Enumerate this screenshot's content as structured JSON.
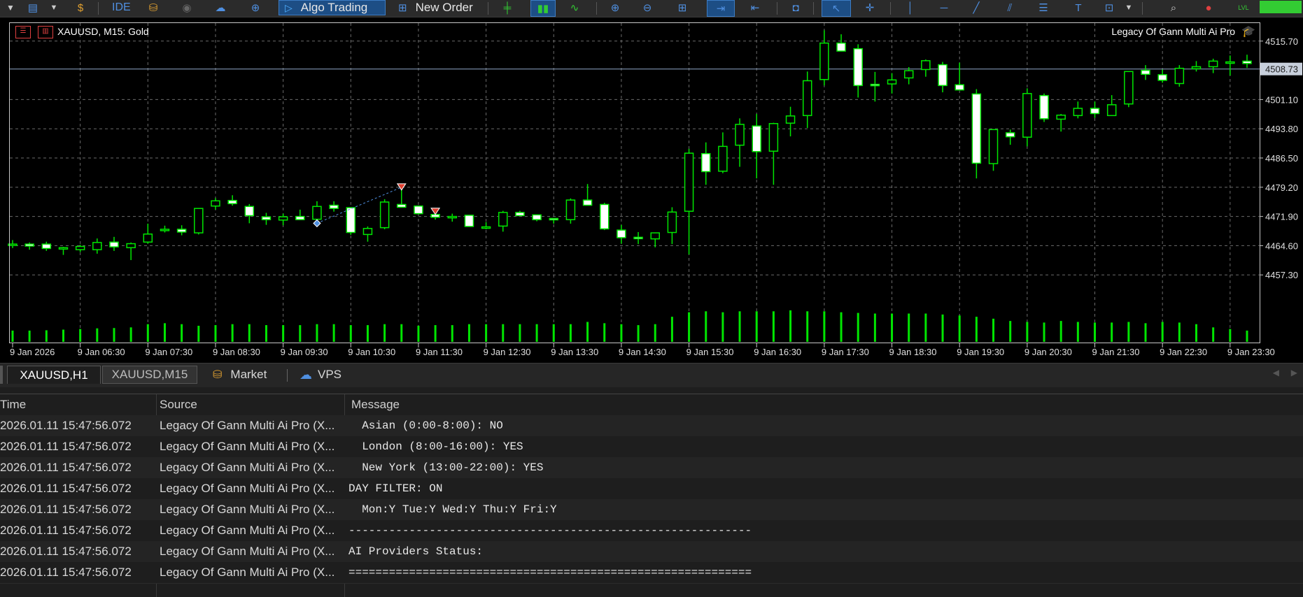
{
  "toolbar": {
    "algo_trading_label": "Algo Trading",
    "new_order_label": "New Order",
    "ide_label": "IDE",
    "lvl_label": "LVL"
  },
  "chart": {
    "title": "XAUUSD, M15:  Gold",
    "indicator_title": "Legacy Of Gann Multi Ai Pro",
    "current_price_label": "4508.73",
    "colors": {
      "bull_body": "#000000",
      "bear_body": "#ffffff",
      "wick": "#00e600",
      "volume": "#00e600",
      "grid": "#6b6b6b",
      "price_line": "#8fa8c8"
    }
  },
  "chart_data": {
    "type": "candlestick",
    "symbol": "XAUUSD",
    "timeframe": "M15",
    "y_ticks": [
      4515.7,
      4508.73,
      4501.1,
      4493.8,
      4486.5,
      4479.2,
      4471.9,
      4464.6,
      4457.3
    ],
    "y_range": [
      4454.2,
      4520.2
    ],
    "x_ticks": [
      "9 Jan 2026",
      "9 Jan 06:30",
      "9 Jan 07:30",
      "9 Jan 08:30",
      "9 Jan 09:30",
      "9 Jan 10:30",
      "9 Jan 11:30",
      "9 Jan 12:30",
      "9 Jan 13:30",
      "9 Jan 14:30",
      "9 Jan 15:30",
      "9 Jan 16:30",
      "9 Jan 17:30",
      "9 Jan 18:30",
      "9 Jan 19:30",
      "9 Jan 20:30",
      "9 Jan 21:30",
      "9 Jan 22:30",
      "9 Jan 23:30"
    ],
    "current_price": 4508.73,
    "candles": [
      [
        4465.0,
        4466.0,
        4464.0,
        4465.0
      ],
      [
        4465.0,
        4465.4,
        4463.6,
        4464.5
      ],
      [
        4465.0,
        4465.6,
        4463.3,
        4463.9
      ],
      [
        4464.1,
        4464.3,
        4462.3,
        4464.1
      ],
      [
        4463.6,
        4464.8,
        4463.0,
        4464.4
      ],
      [
        4463.6,
        4466.4,
        4462.6,
        4465.4
      ],
      [
        4465.5,
        4466.8,
        4463.3,
        4464.3
      ],
      [
        4464.1,
        4465.4,
        4461.0,
        4465.1
      ],
      [
        4465.5,
        4470.1,
        4465.1,
        4467.5
      ],
      [
        4468.5,
        4469.6,
        4467.9,
        4468.7
      ],
      [
        4468.7,
        4469.7,
        4467.2,
        4468.0
      ],
      [
        4467.8,
        4473.9,
        4467.4,
        4473.9
      ],
      [
        4474.5,
        4476.5,
        4473.6,
        4475.8
      ],
      [
        4475.9,
        4477.2,
        4474.6,
        4475.1
      ],
      [
        4474.4,
        4475.0,
        4470.2,
        4472.1
      ],
      [
        4471.8,
        4472.8,
        4469.8,
        4471.1
      ],
      [
        4471.0,
        4472.6,
        4469.7,
        4471.8
      ],
      [
        4471.9,
        4473.6,
        4471.3,
        4471.1
      ],
      [
        4471.2,
        4475.7,
        4470.1,
        4474.4
      ],
      [
        4474.7,
        4475.7,
        4473.1,
        4473.9
      ],
      [
        4474.1,
        4474.1,
        4467.3,
        4467.9
      ],
      [
        4467.4,
        4469.4,
        4465.6,
        4468.9
      ],
      [
        4469.1,
        4476.2,
        4468.7,
        4475.5
      ],
      [
        4474.9,
        4478.8,
        4474.9,
        4474.2
      ],
      [
        4474.5,
        4474.5,
        4472.4,
        4472.6
      ],
      [
        4472.4,
        4473.3,
        4471.1,
        4471.7
      ],
      [
        4471.7,
        4472.6,
        4470.6,
        4471.9
      ],
      [
        4472.2,
        4472.2,
        4469.3,
        4469.4
      ],
      [
        4469.2,
        4470.5,
        4468.7,
        4469.3
      ],
      [
        4469.5,
        4473.3,
        4468.1,
        4472.9
      ],
      [
        4472.9,
        4473.3,
        4472.2,
        4472.1
      ],
      [
        4472.3,
        4472.4,
        4470.7,
        4471.1
      ],
      [
        4471.4,
        4471.4,
        4470.1,
        4471.1
      ],
      [
        4471.1,
        4476.4,
        4470.1,
        4476.0
      ],
      [
        4476.0,
        4480.0,
        4474.9,
        4474.7
      ],
      [
        4474.9,
        4475.3,
        4468.5,
        4468.8
      ],
      [
        4468.5,
        4469.8,
        4465.1,
        4466.6
      ],
      [
        4466.7,
        4468.0,
        4465.0,
        4466.4
      ],
      [
        4466.3,
        4467.7,
        4464.2,
        4467.8
      ],
      [
        4467.9,
        4474.2,
        4465.0,
        4473.0
      ],
      [
        4473.2,
        4488.8,
        4462.4,
        4487.7
      ],
      [
        4487.6,
        4490.4,
        4479.8,
        4483.1
      ],
      [
        4483.2,
        4492.9,
        4482.7,
        4489.4
      ],
      [
        4489.7,
        4496.4,
        4484.3,
        4494.9
      ],
      [
        4494.5,
        4497.5,
        4481.4,
        4488.1
      ],
      [
        4488.2,
        4495.3,
        4479.8,
        4495.1
      ],
      [
        4495.2,
        4499.3,
        4491.9,
        4497.0
      ],
      [
        4497.1,
        4508.1,
        4494.0,
        4505.8
      ],
      [
        4506.1,
        4518.4,
        4504.6,
        4515.2
      ],
      [
        4515.2,
        4517.4,
        4513.8,
        4513.2
      ],
      [
        4513.8,
        4514.9,
        4501.6,
        4504.6
      ],
      [
        4504.9,
        4508.0,
        4500.6,
        4504.6
      ],
      [
        4505.0,
        4507.7,
        4502.6,
        4506.0
      ],
      [
        4506.5,
        4509.2,
        4504.9,
        4508.3
      ],
      [
        4508.6,
        4511.1,
        4506.8,
        4510.8
      ],
      [
        4509.8,
        4510.5,
        4502.9,
        4504.6
      ],
      [
        4504.8,
        4510.3,
        4503.4,
        4503.5
      ],
      [
        4502.5,
        4503.7,
        4481.4,
        4485.2
      ],
      [
        4485.1,
        4493.4,
        4483.3,
        4493.6
      ],
      [
        4492.8,
        4493.6,
        4489.8,
        4491.8
      ],
      [
        4491.7,
        4503.9,
        4489.4,
        4502.6
      ],
      [
        4502.1,
        4502.6,
        4495.5,
        4496.3
      ],
      [
        4496.2,
        4497.5,
        4493.1,
        4497.2
      ],
      [
        4497.1,
        4500.6,
        4496.4,
        4498.9
      ],
      [
        4498.9,
        4500.6,
        4496.5,
        4497.6
      ],
      [
        4497.1,
        4502.2,
        4497.1,
        4499.8
      ],
      [
        4500.0,
        4508.1,
        4499.2,
        4508.1
      ],
      [
        4508.4,
        4509.7,
        4506.0,
        4507.4
      ],
      [
        4507.3,
        4508.6,
        4505.3,
        4505.9
      ],
      [
        4505.1,
        4509.7,
        4504.3,
        4508.9
      ],
      [
        4508.8,
        4510.7,
        4508.1,
        4509.3
      ],
      [
        4509.3,
        4511.3,
        4507.7,
        4510.7
      ],
      [
        4510.5,
        4512.1,
        4507.1,
        4510.5
      ],
      [
        4510.7,
        4512.3,
        4509.0,
        4510.1
      ]
    ],
    "volumes": [
      0.35,
      0.35,
      0.36,
      0.38,
      0.4,
      0.42,
      0.43,
      0.45,
      0.55,
      0.58,
      0.55,
      0.5,
      0.52,
      0.55,
      0.55,
      0.52,
      0.52,
      0.52,
      0.55,
      0.55,
      0.52,
      0.52,
      0.55,
      0.55,
      0.5,
      0.52,
      0.52,
      0.55,
      0.55,
      0.55,
      0.55,
      0.55,
      0.55,
      0.55,
      0.62,
      0.58,
      0.55,
      0.52,
      0.55,
      0.78,
      0.92,
      0.95,
      0.92,
      0.95,
      0.95,
      0.95,
      0.98,
      0.95,
      0.95,
      0.92,
      0.9,
      0.88,
      0.88,
      0.88,
      0.88,
      0.85,
      0.82,
      0.78,
      0.72,
      0.65,
      0.62,
      0.6,
      0.65,
      0.62,
      0.6,
      0.6,
      0.62,
      0.58,
      0.62,
      0.6,
      0.55,
      0.45,
      0.4,
      0.35
    ],
    "signals": [
      {
        "index": 18,
        "kind": "buy",
        "price": 4470.2
      },
      {
        "index": 23,
        "kind": "sell",
        "price": 4479.2
      },
      {
        "index": 25,
        "kind": "sell",
        "price": 4473.1
      }
    ]
  },
  "tabs": {
    "h1": "XAUUSD,H1",
    "m15": "XAUUSD,M15",
    "market": "Market",
    "vps": "VPS"
  },
  "journal": {
    "headers": {
      "time": "Time",
      "source": "Source",
      "message": "Message"
    },
    "rows": [
      {
        "time": "2026.01.11 15:47:56.072",
        "source": "Legacy Of Gann Multi Ai Pro (X...",
        "message": "  Asian (0:00-8:00): NO"
      },
      {
        "time": "2026.01.11 15:47:56.072",
        "source": "Legacy Of Gann Multi Ai Pro (X...",
        "message": "  London (8:00-16:00): YES"
      },
      {
        "time": "2026.01.11 15:47:56.072",
        "source": "Legacy Of Gann Multi Ai Pro (X...",
        "message": "  New York (13:00-22:00): YES"
      },
      {
        "time": "2026.01.11 15:47:56.072",
        "source": "Legacy Of Gann Multi Ai Pro (X...",
        "message": "DAY FILTER: ON"
      },
      {
        "time": "2026.01.11 15:47:56.072",
        "source": "Legacy Of Gann Multi Ai Pro (X...",
        "message": "  Mon:Y Tue:Y Wed:Y Thu:Y Fri:Y"
      },
      {
        "time": "2026.01.11 15:47:56.072",
        "source": "Legacy Of Gann Multi Ai Pro (X...",
        "message": "------------------------------------------------------------"
      },
      {
        "time": "2026.01.11 15:47:56.072",
        "source": "Legacy Of Gann Multi Ai Pro (X...",
        "message": "AI Providers Status:"
      },
      {
        "time": "2026.01.11 15:47:56.072",
        "source": "Legacy Of Gann Multi Ai Pro (X...",
        "message": "============================================================"
      }
    ]
  }
}
